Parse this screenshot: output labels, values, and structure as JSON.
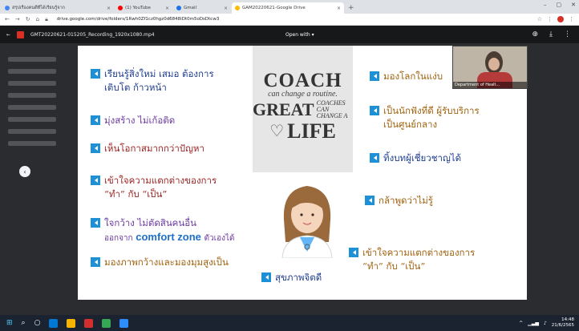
{
  "browser": {
    "tabs": [
      {
        "label": "สรุปเรื่องคนดีที่ได้เรียนรู้จาก",
        "color": "#4285f4",
        "active": false,
        "wide": true
      },
      {
        "label": "(1) YouTube",
        "color": "#ff0000",
        "active": false,
        "wide": false
      },
      {
        "label": "Gmail",
        "color": "#1a73e8",
        "active": false,
        "wide": false
      },
      {
        "label": "GAM20220621-Google Drive",
        "color": "#fbbc04",
        "active": true,
        "wide": true
      }
    ],
    "url": "drive.google.com/drive/folders/1Rwh0Zf1cz0hgz0d6848iDt0m5oDsDtcw3"
  },
  "viewer": {
    "file_name": "GMT20220621-015205_Recording_1920x1080.mp4",
    "open_with": "Open with ▾"
  },
  "slide": {
    "left_items": [
      {
        "line1": "เรียนรู้สิ่งใหม่ เสมอ ต้องการ",
        "line2": "เติบโต ก้าวหน้า",
        "color": "c-blue"
      },
      {
        "line1": "มุ่งสร้าง ไม่เก้อติด",
        "line2": "",
        "color": "c-purple"
      },
      {
        "line1": "เห็นโอกาสมากกว่าปัญหา",
        "line2": "",
        "color": "c-red"
      },
      {
        "line1": "เข้าใจความแตกต่างของการ",
        "line2": "“ทำ” กับ “เป็น”",
        "color": "c-red"
      },
      {
        "line1": "ใจกว้าง ไม่ตัดสินคนอื่น",
        "line2_a": "ออกจาก",
        "line2_em": "comfort zone",
        "line2_b": "ตัวเองได้",
        "color": "c-purple"
      },
      {
        "line1": "มองภาพกว้างและมองมุมสูงเป็น",
        "line2": "",
        "color": "c-gold"
      }
    ],
    "right_items": [
      {
        "line1": "มองโลกในแง่บ",
        "line2": "",
        "color": "c-gold"
      },
      {
        "line1": "เป็นนักฟังที่ดี ผู้รับบริการ",
        "line2": "เป็นศูนย์กลาง",
        "color": "c-gold"
      },
      {
        "line1": "ทิ้งบทผู้เชี่ยวชาญได้",
        "line2": "",
        "color": "c-navy"
      },
      {
        "line1": "กล้าพูดว่าไม่รู้",
        "line2": "",
        "color": "c-gold"
      },
      {
        "line1": "เข้าใจความแตกต่างของการ",
        "line2": "“ทำ” กับ “เป็น”",
        "color": "c-gold"
      }
    ],
    "bottom_item": "สุขภาพจิตดี",
    "poster": {
      "coach": "COACH",
      "sub": "can change a routine.",
      "great": "GREAT",
      "coaches": "COACHES",
      "coaches_sub": "CAN CHANGE A",
      "life": "LIFE"
    }
  },
  "webcam": {
    "label": "Department of Healt..."
  },
  "taskbar": {
    "time": "14:48",
    "date": "21/6/2565"
  },
  "colors": {
    "bullet": "#1e90d6"
  }
}
